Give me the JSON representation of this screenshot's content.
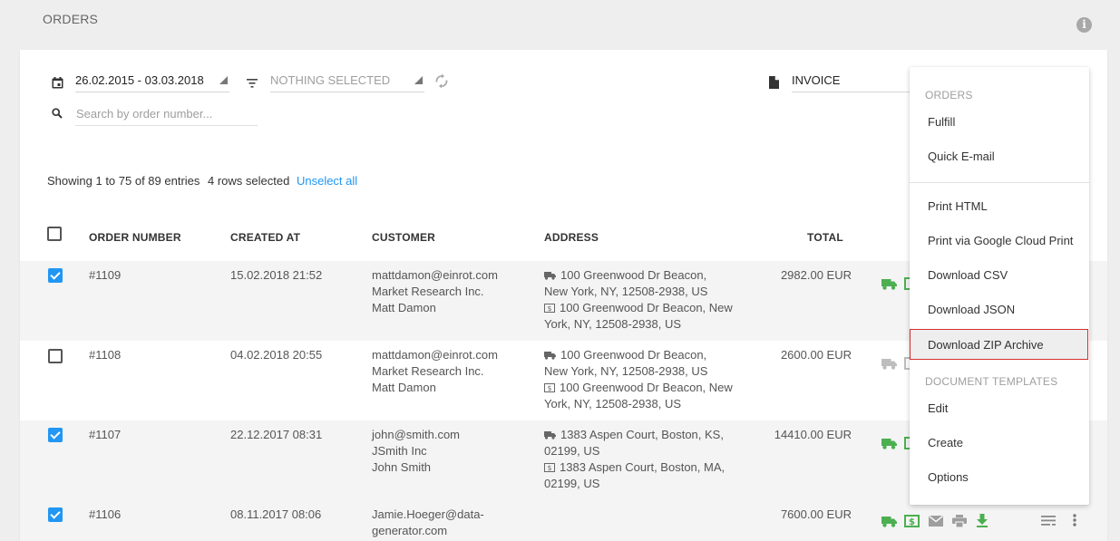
{
  "header": {
    "title": "ORDERS"
  },
  "filters": {
    "date_range": "26.02.2015 - 03.03.2018",
    "filter_placeholder": "NOTHING SELECTED",
    "document": "INVOICE",
    "search_placeholder": "Search by order number..."
  },
  "summary": {
    "entries": "Showing 1 to 75 of 89 entries",
    "selected": "4 rows selected",
    "unselect": "Unselect all"
  },
  "table": {
    "columns": {
      "order_number": "ORDER NUMBER",
      "created_at": "CREATED AT",
      "customer": "CUSTOMER",
      "address": "ADDRESS",
      "total": "TOTAL"
    },
    "rows": [
      {
        "order": "#1109",
        "created": "15.02.2018 21:52",
        "customer": [
          "mattdamon@einrot.com",
          "Market Research Inc.",
          "Matt Damon"
        ],
        "ship": [
          "100 Greenwood Dr Beacon,",
          "New York, NY, 12508-2938, US"
        ],
        "bill": [
          "100 Greenwood Dr Beacon, New",
          "York, NY, 12508-2938, US"
        ],
        "total": "2982.00 EUR"
      },
      {
        "order": "#1108",
        "created": "04.02.2018 20:55",
        "customer": [
          "mattdamon@einrot.com",
          "Market Research Inc.",
          "Matt Damon"
        ],
        "ship": [
          "100 Greenwood Dr Beacon,",
          "New York, NY, 12508-2938, US"
        ],
        "bill": [
          "100 Greenwood Dr Beacon, New",
          "York, NY, 12508-2938, US"
        ],
        "total": "2600.00 EUR"
      },
      {
        "order": "#1107",
        "created": "22.12.2017 08:31",
        "customer": [
          "john@smith.com",
          "JSmith Inc",
          "John Smith"
        ],
        "ship": [
          "1383 Aspen Court, Boston, KS,",
          "02199, US"
        ],
        "bill": [
          "1383 Aspen Court, Boston, MA,",
          "02199, US"
        ],
        "total": "14410.00 EUR"
      },
      {
        "order": "#1106",
        "created": "08.11.2017 08:06",
        "customer": [
          "Jamie.Hoeger@data-",
          "generator.com"
        ],
        "total": "7600.00 EUR"
      }
    ]
  },
  "menu": {
    "orders_header": "ORDERS",
    "fulfill": "Fulfill",
    "quick_email": "Quick E-mail",
    "print_html": "Print HTML",
    "print_cloud": "Print via Google Cloud Print",
    "download_csv": "Download CSV",
    "download_json": "Download JSON",
    "download_zip": "Download ZIP Archive",
    "templates_header": "DOCUMENT TEMPLATES",
    "edit": "Edit",
    "create": "Create",
    "options": "Options"
  },
  "colors": {
    "accent": "#2196f3",
    "action_green": "#4caf50",
    "action_gray": "#9e9e9e",
    "highlight_border": "#d32f2f"
  }
}
